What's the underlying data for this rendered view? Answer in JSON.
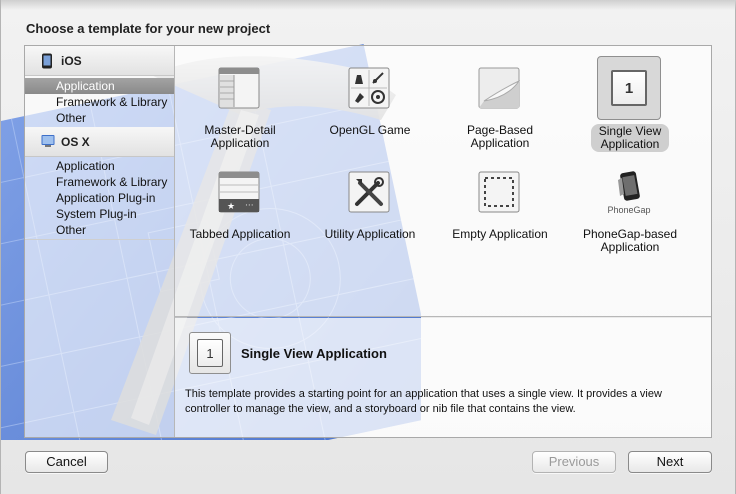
{
  "dialog": {
    "heading": "Choose a template for your new project"
  },
  "sidebar": {
    "sections": [
      {
        "name": "iOS",
        "icon": "iphone-icon",
        "items": [
          "Application",
          "Framework & Library",
          "Other"
        ],
        "selected": "Application"
      },
      {
        "name": "OS X",
        "icon": "mac-finder-icon",
        "items": [
          "Application",
          "Framework & Library",
          "Application Plug-in",
          "System Plug-in",
          "Other"
        ]
      }
    ]
  },
  "templates": [
    {
      "label": "Master-Detail\nApplication",
      "icon": "master-detail-icon"
    },
    {
      "label": "OpenGL Game",
      "icon": "opengl-game-icon"
    },
    {
      "label": "Page-Based\nApplication",
      "icon": "page-curl-icon"
    },
    {
      "label": "Single View\nApplication",
      "icon": "single-view-icon",
      "selected": true,
      "glyph": "1"
    },
    {
      "label": "Tabbed Application",
      "icon": "tabbed-icon"
    },
    {
      "label": "Utility Application",
      "icon": "utility-tools-icon"
    },
    {
      "label": "Empty Application",
      "icon": "empty-dashed-icon"
    },
    {
      "label": "PhoneGap-based\nApplication",
      "icon": "phonegap-icon",
      "logo_text": "PhoneGap"
    }
  ],
  "detail": {
    "glyph": "1",
    "title": "Single View Application",
    "description": "This template provides a starting point for an application that uses a single view. It provides a view controller to manage the view, and a storyboard or nib file that contains the view."
  },
  "buttons": {
    "cancel": "Cancel",
    "previous": "Previous",
    "next": "Next"
  },
  "colors": {
    "selection": "#939393",
    "blueprint": "#3c66c4",
    "window_bg": "#ececec"
  }
}
